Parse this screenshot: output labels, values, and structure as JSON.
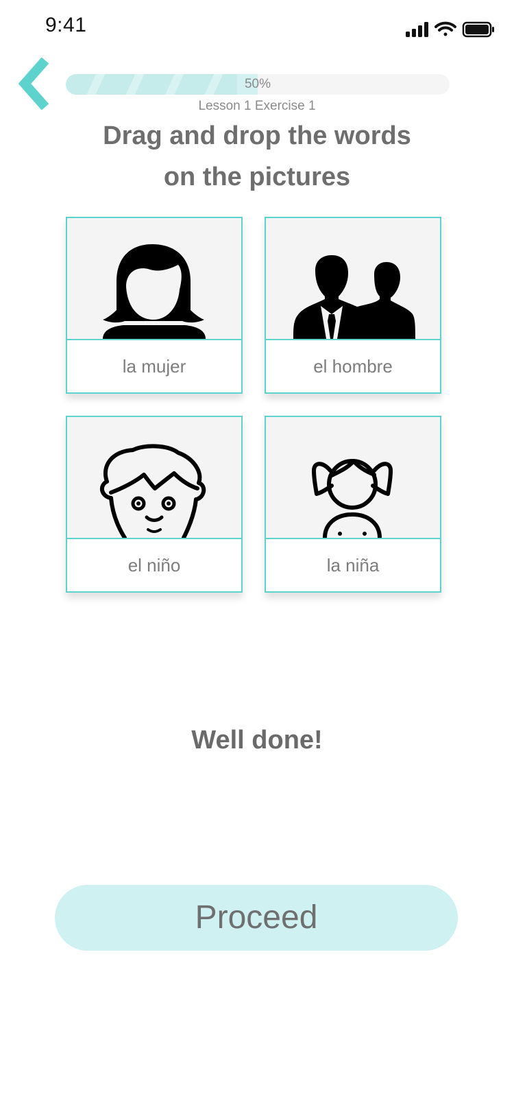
{
  "status_bar": {
    "time": "9:41",
    "icons": [
      "cellular-signal-icon",
      "wifi-icon",
      "battery-icon"
    ]
  },
  "header": {
    "back_icon": "chevron-left-icon",
    "progress": {
      "value": 0.5,
      "label": "50%"
    },
    "lesson_label": "Lesson 1 Exercise 1"
  },
  "instruction": {
    "line1": "Drag and drop the words",
    "line2": "on the pictures"
  },
  "cards": [
    {
      "word": "la mujer",
      "icon": "woman-icon"
    },
    {
      "word": "el hombre",
      "icon": "men-icon"
    },
    {
      "word": "el niño",
      "icon": "boy-icon"
    },
    {
      "word": "la niña",
      "icon": "girl-icon"
    }
  ],
  "feedback": "Well done!",
  "proceed_label": "Proceed",
  "colors": {
    "accent": "#5ed3ce",
    "progress_fill": "#c5eceb",
    "button_bg": "#cff1f1",
    "text_gray": "#6e6e6e"
  }
}
